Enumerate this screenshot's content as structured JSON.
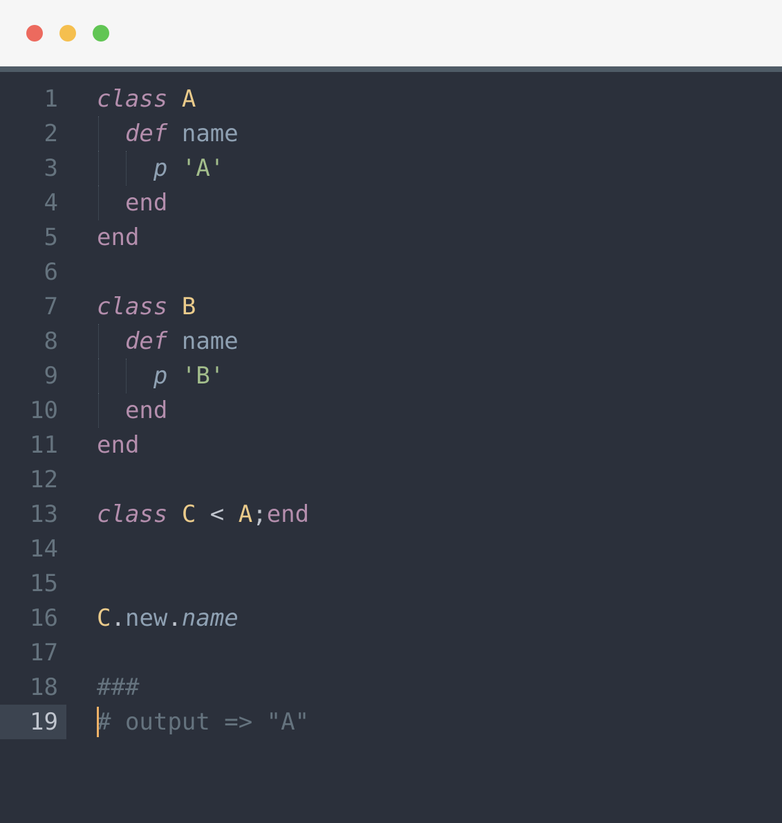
{
  "window": {
    "traffic": {
      "close_color": "#ec6a5e",
      "min_color": "#f5bf4f",
      "max_color": "#61c554"
    }
  },
  "editor": {
    "cursor_line": 19,
    "lines": [
      {
        "n": 1,
        "tokens": [
          {
            "t": "class ",
            "c": "kw-class"
          },
          {
            "t": "A",
            "c": "const"
          }
        ]
      },
      {
        "n": 2,
        "indent": 1,
        "tokens": [
          {
            "t": "  ",
            "c": "white"
          },
          {
            "t": "def ",
            "c": "kw-def"
          },
          {
            "t": "name",
            "c": "ident"
          }
        ]
      },
      {
        "n": 3,
        "indent": 2,
        "tokens": [
          {
            "t": "    ",
            "c": "white"
          },
          {
            "t": "p ",
            "c": "func"
          },
          {
            "t": "'A'",
            "c": "str"
          }
        ]
      },
      {
        "n": 4,
        "indent": 1,
        "tokens": [
          {
            "t": "  ",
            "c": "white"
          },
          {
            "t": "end",
            "c": "kw-end"
          }
        ]
      },
      {
        "n": 5,
        "tokens": [
          {
            "t": "end",
            "c": "kw-end"
          }
        ]
      },
      {
        "n": 6,
        "tokens": []
      },
      {
        "n": 7,
        "tokens": [
          {
            "t": "class ",
            "c": "kw-class"
          },
          {
            "t": "B",
            "c": "const"
          }
        ]
      },
      {
        "n": 8,
        "indent": 1,
        "tokens": [
          {
            "t": "  ",
            "c": "white"
          },
          {
            "t": "def ",
            "c": "kw-def"
          },
          {
            "t": "name",
            "c": "ident"
          }
        ]
      },
      {
        "n": 9,
        "indent": 2,
        "tokens": [
          {
            "t": "    ",
            "c": "white"
          },
          {
            "t": "p ",
            "c": "func"
          },
          {
            "t": "'B'",
            "c": "str"
          }
        ]
      },
      {
        "n": 10,
        "indent": 1,
        "tokens": [
          {
            "t": "  ",
            "c": "white"
          },
          {
            "t": "end",
            "c": "kw-end"
          }
        ]
      },
      {
        "n": 11,
        "tokens": [
          {
            "t": "end",
            "c": "kw-end"
          }
        ]
      },
      {
        "n": 12,
        "tokens": []
      },
      {
        "n": 13,
        "tokens": [
          {
            "t": "class ",
            "c": "kw-class"
          },
          {
            "t": "C ",
            "c": "const"
          },
          {
            "t": "< ",
            "c": "op"
          },
          {
            "t": "A",
            "c": "const"
          },
          {
            "t": ";",
            "c": "op"
          },
          {
            "t": "end",
            "c": "kw-end"
          }
        ]
      },
      {
        "n": 14,
        "tokens": []
      },
      {
        "n": 15,
        "tokens": []
      },
      {
        "n": 16,
        "tokens": [
          {
            "t": "C",
            "c": "const"
          },
          {
            "t": ".",
            "c": "punct"
          },
          {
            "t": "new",
            "c": "ident"
          },
          {
            "t": ".",
            "c": "punct"
          },
          {
            "t": "name",
            "c": "method-i"
          }
        ]
      },
      {
        "n": 17,
        "tokens": []
      },
      {
        "n": 18,
        "tokens": [
          {
            "t": "###",
            "c": "comment"
          }
        ]
      },
      {
        "n": 19,
        "cursor_at_start": true,
        "tokens": [
          {
            "t": "# output => \"A\"",
            "c": "comment"
          }
        ]
      }
    ]
  }
}
